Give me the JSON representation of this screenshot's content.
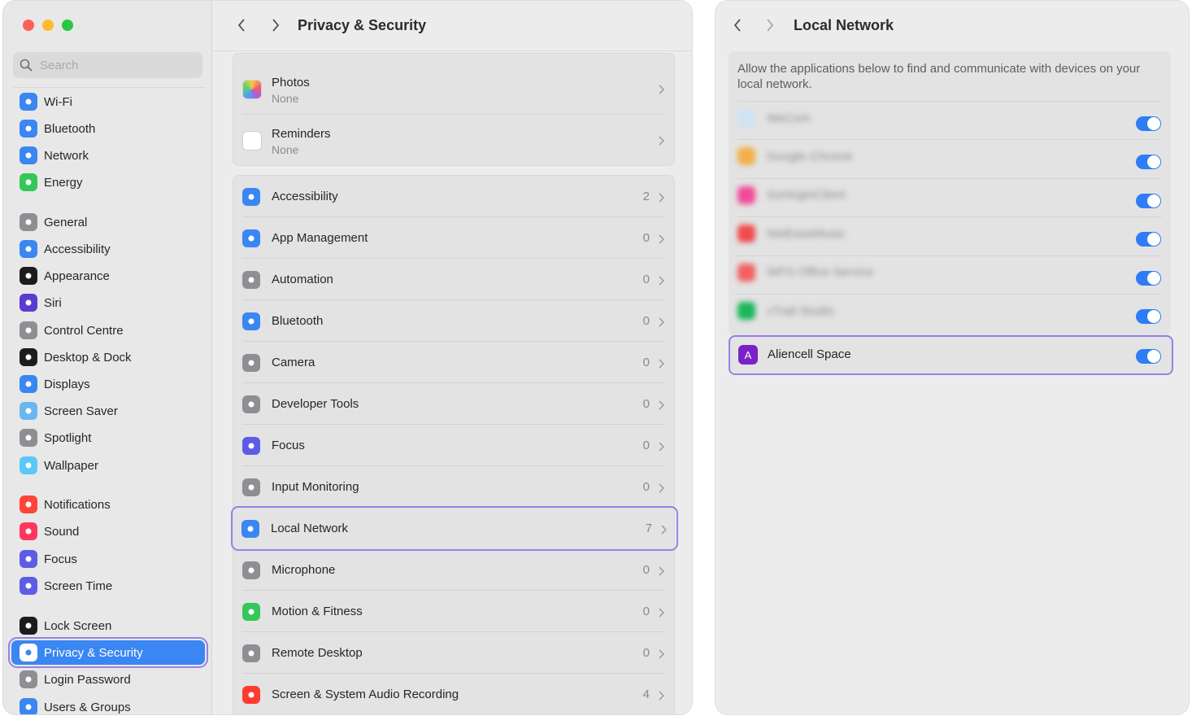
{
  "window1": {
    "search_placeholder": "Search",
    "title": "Privacy & Security",
    "sidebar": [
      {
        "label": "Wi-Fi",
        "icon": "wifi-icon",
        "color": "#3a86f2"
      },
      {
        "label": "Bluetooth",
        "icon": "bluetooth-icon",
        "color": "#3a86f2"
      },
      {
        "label": "Network",
        "icon": "globe-icon",
        "color": "#3a86f2"
      },
      {
        "label": "Energy",
        "icon": "bolt-icon",
        "color": "#34c759"
      },
      {
        "label": "General",
        "icon": "gear-icon",
        "color": "#8e8e93"
      },
      {
        "label": "Accessibility",
        "icon": "accessibility-icon",
        "color": "#3a86f2"
      },
      {
        "label": "Appearance",
        "icon": "appearance-icon",
        "color": "#1c1c1e"
      },
      {
        "label": "Siri",
        "icon": "siri-icon",
        "color": "#5b3bd1"
      },
      {
        "label": "Control Centre",
        "icon": "control-centre-icon",
        "color": "#8e8e93"
      },
      {
        "label": "Desktop & Dock",
        "icon": "dock-icon",
        "color": "#1c1c1e"
      },
      {
        "label": "Displays",
        "icon": "sun-icon",
        "color": "#3a86f2"
      },
      {
        "label": "Screen Saver",
        "icon": "screen-saver-icon",
        "color": "#6ab7f0"
      },
      {
        "label": "Spotlight",
        "icon": "magnifier-icon",
        "color": "#8e8e93"
      },
      {
        "label": "Wallpaper",
        "icon": "flower-icon",
        "color": "#5ac8fa"
      },
      {
        "label": "Notifications",
        "icon": "bell-icon",
        "color": "#ff453a"
      },
      {
        "label": "Sound",
        "icon": "speaker-icon",
        "color": "#ff375f"
      },
      {
        "label": "Focus",
        "icon": "moon-icon",
        "color": "#5e5ce6"
      },
      {
        "label": "Screen Time",
        "icon": "hourglass-icon",
        "color": "#5e5ce6"
      },
      {
        "label": "Lock Screen",
        "icon": "lock-icon",
        "color": "#1c1c1e"
      },
      {
        "label": "Privacy & Security",
        "icon": "hand-icon",
        "color": "#3a86f2",
        "active": true
      },
      {
        "label": "Login Password",
        "icon": "lock-icon",
        "color": "#8e8e93"
      },
      {
        "label": "Users & Groups",
        "icon": "users-icon",
        "color": "#3a86f2"
      }
    ],
    "top_group": [
      {
        "label": "Photos",
        "sub": "None",
        "icon": "photos-icon"
      },
      {
        "label": "Reminders",
        "sub": "None",
        "icon": "reminders-icon"
      }
    ],
    "perm_group": [
      {
        "label": "Accessibility",
        "count": "2",
        "icon": "accessibility-icon",
        "color": "#3a86f2"
      },
      {
        "label": "App Management",
        "count": "0",
        "icon": "app-store-icon",
        "color": "#3a86f2"
      },
      {
        "label": "Automation",
        "count": "0",
        "icon": "gears-icon",
        "color": "#8e8e93"
      },
      {
        "label": "Bluetooth",
        "count": "0",
        "icon": "bluetooth-icon",
        "color": "#3a86f2"
      },
      {
        "label": "Camera",
        "count": "0",
        "icon": "camera-icon",
        "color": "#8e8e93"
      },
      {
        "label": "Developer Tools",
        "count": "0",
        "icon": "hammer-icon",
        "color": "#8e8e93"
      },
      {
        "label": "Focus",
        "count": "0",
        "icon": "moon-icon",
        "color": "#5e5ce6"
      },
      {
        "label": "Input Monitoring",
        "count": "0",
        "icon": "keyboard-icon",
        "color": "#8e8e93"
      },
      {
        "label": "Local Network",
        "count": "7",
        "icon": "globe-icon",
        "color": "#3a86f2",
        "highlight": true
      },
      {
        "label": "Microphone",
        "count": "0",
        "icon": "microphone-icon",
        "color": "#8e8e93"
      },
      {
        "label": "Motion & Fitness",
        "count": "0",
        "icon": "runner-icon",
        "color": "#34c759"
      },
      {
        "label": "Remote Desktop",
        "count": "0",
        "icon": "binoculars-icon",
        "color": "#8e8e93"
      },
      {
        "label": "Screen & System Audio Recording",
        "count": "4",
        "icon": "record-icon",
        "color": "#ff3b30"
      }
    ]
  },
  "window2": {
    "title": "Local Network",
    "description": "Allow the applications below to find and communicate with devices on your local network.",
    "blurred_apps": [
      {
        "label": "WeCom",
        "color": "#cfe3f3",
        "enabled": true
      },
      {
        "label": "Google Chrome",
        "color": "#f2b04a",
        "enabled": true
      },
      {
        "label": "SunloginClient",
        "color": "#f04a9a",
        "enabled": true
      },
      {
        "label": "NetEaseMusic",
        "color": "#f24b4b",
        "enabled": true
      },
      {
        "label": "WPS Office Service",
        "color": "#f26060",
        "enabled": true
      },
      {
        "label": "vTrail Studio",
        "color": "#1bb65a",
        "enabled": true
      }
    ],
    "highlight_app": {
      "label": "Aliencell Space",
      "glyph": "A",
      "color": "#7b21c8",
      "enabled": true
    }
  }
}
